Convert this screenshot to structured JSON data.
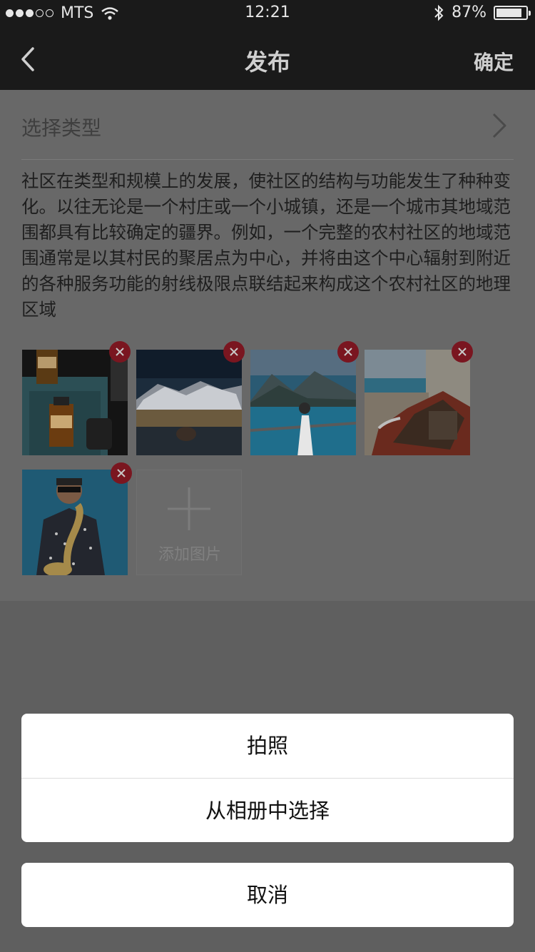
{
  "status_bar": {
    "carrier": "MTS",
    "time": "12:21",
    "battery": "87%",
    "battery_level": 0.87,
    "signal_bars": 3,
    "icons": [
      "signal-dots-icon",
      "wifi-icon",
      "bluetooth-icon",
      "battery-icon"
    ]
  },
  "nav": {
    "back_icon": "chevron-left-icon",
    "title": "发布",
    "confirm": "确定"
  },
  "type_selector": {
    "label": "选择类型",
    "icon": "chevron-right-icon"
  },
  "body_text": "社区在类型和规模上的发展，使社区的结构与功能发生了种种变化。以往无论是一个村庄或一个小城镇，还是一个城市其地域范围都具有比较确定的疆界。例如，一个完整的农村社区的地域范围通常是以其村民的聚居点为中心，并将由这个中心辐射到附近的各种服务功能的射线极限点联结起来构成这个农村社区的地理区域",
  "images": [
    {
      "name": "bottles-photo"
    },
    {
      "name": "mountain-lake-photo"
    },
    {
      "name": "kayak-photo"
    },
    {
      "name": "beach-boat-photo"
    },
    {
      "name": "saxophone-photo"
    }
  ],
  "add_image": {
    "label": "添加图片",
    "icon": "plus-icon"
  },
  "action_sheet": {
    "options": [
      "拍照",
      "从相册中选择"
    ],
    "cancel": "取消"
  },
  "colors": {
    "overlay": "#5f5f5f",
    "delete_badge": "#7a1620",
    "sheet_bg": "#ffffff"
  }
}
